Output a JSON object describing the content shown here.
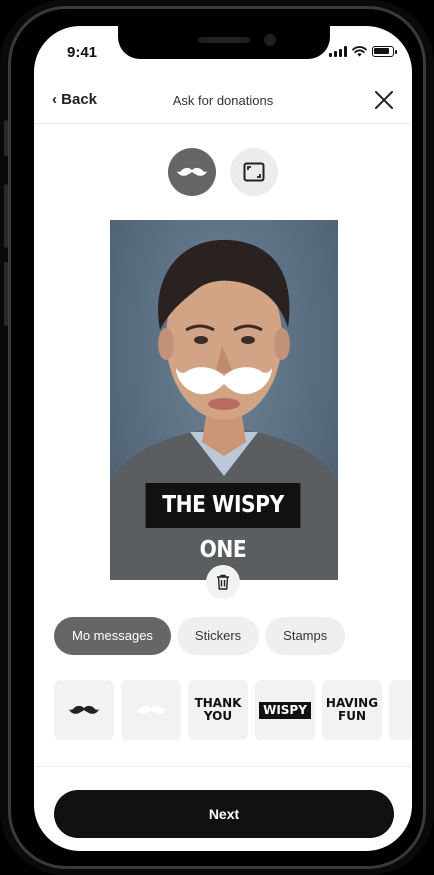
{
  "status_bar": {
    "time": "9:41"
  },
  "nav": {
    "back_label": "‹ Back",
    "title": "Ask for donations"
  },
  "mode_toggle": [
    {
      "icon": "mustache-icon",
      "active": true
    },
    {
      "icon": "crop-frame-icon",
      "active": false
    }
  ],
  "photo": {
    "caption": "THE WISPY ONE",
    "overlay_icon": "mustache-icon"
  },
  "tabs": [
    {
      "label": "Mo messages",
      "active": true
    },
    {
      "label": "Stickers",
      "active": false
    },
    {
      "label": "Stamps",
      "active": false
    }
  ],
  "stickers": [
    {
      "type": "icon",
      "icon": "mustache-icon"
    },
    {
      "type": "icon",
      "icon": "white-mustache-icon"
    },
    {
      "type": "text",
      "line1": "THANK",
      "line2": "YOU"
    },
    {
      "type": "label",
      "text": "WISPY"
    },
    {
      "type": "text",
      "line1": "HAVING",
      "line2": "FUN"
    }
  ],
  "footer": {
    "next_label": "Next"
  }
}
